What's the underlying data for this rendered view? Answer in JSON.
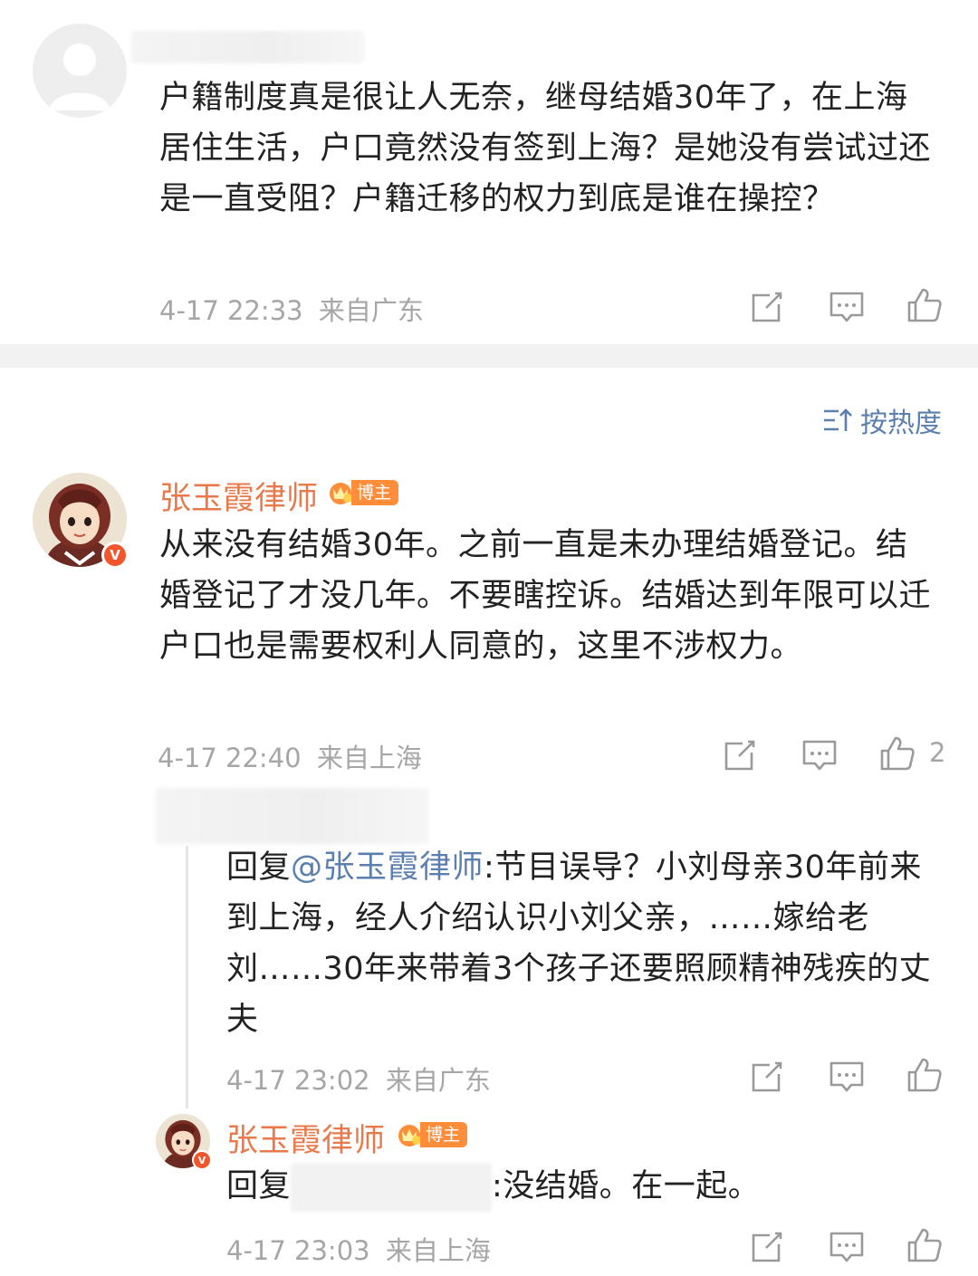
{
  "comment1": {
    "text": "户籍制度真是很让人无奈，继母结婚30年了，在上海居住生活，户口竟然没有签到上海？是她没有尝试过还是一直受阻？户籍迁移的权力到底是谁在操控？",
    "time": "4-17 22:33",
    "location": "来自广东"
  },
  "sort": {
    "label": "按热度"
  },
  "comment2": {
    "author": "张玉霞律师",
    "badge": "博主",
    "text": "从来没有结婚30年。之前一直是未办理结婚登记。结婚登记了才没几年。不要瞎控诉。结婚达到年限可以迁户口也是需要权利人同意的，这里不涉权力。",
    "time": "4-17 22:40",
    "location": "来自上海",
    "like_count": "2"
  },
  "reply1": {
    "prefix": "回复",
    "mention": "@张玉霞律师",
    "text": ":节目误导？小刘母亲30年前来到上海，经人介绍认识小刘父亲，……嫁给老刘……30年来带着3个孩子还要照顾精神残疾的丈夫",
    "time": "4-17 23:02",
    "location": "来自广东"
  },
  "reply2": {
    "author": "张玉霞律师",
    "badge": "博主",
    "prefix": "回复",
    "text": ":没结婚。在一起。",
    "time": "4-17 23:03",
    "location": "来自上海"
  },
  "icons": {
    "share": "share-icon",
    "comment": "comment-icon",
    "like": "thumbs-up-icon",
    "sort": "sort-icon",
    "verified": "verified-v-icon",
    "crown": "crown-icon"
  },
  "colors": {
    "author": "#e8794b",
    "link": "#5b7fae",
    "meta": "#a6a6a6",
    "badge": "#ff8d3a",
    "verified": "#f1562c"
  }
}
